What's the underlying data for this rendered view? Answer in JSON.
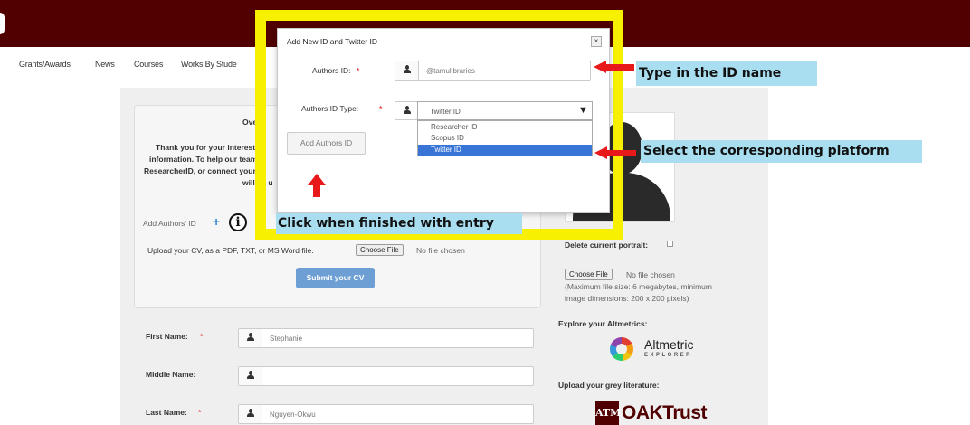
{
  "nav": {
    "items": [
      "Grants/Awards",
      "News",
      "Courses",
      "Works By Stude"
    ]
  },
  "upload_panel": {
    "overview_fragment": "Over",
    "intro_line1": "Thank you for your interest in",
    "intro_line2": "information. To help our team",
    "intro_line3": "ResearcherID, or connect your",
    "intro_line4": "will be u",
    "add_authors_id_label": "Add Authors' ID",
    "upload_cv_text": "Upload your CV, as a PDF, TXT, or MS Word file.",
    "choose_file_label": "Choose File",
    "no_file_text": "No file chosen",
    "submit_cv_label": "Submit your CV"
  },
  "form": {
    "first_name_label": "First Name:",
    "first_name_value": "Stephanie",
    "middle_name_label": "Middle Name:",
    "middle_name_value": "",
    "last_name_label": "Last Name:",
    "last_name_value": "Nguyen-Okwu",
    "required_mark": "*"
  },
  "sidebar": {
    "delete_portrait_label": "Delete current portrait:",
    "choose_file_label": "Choose File",
    "no_file_text": "No file chosen",
    "file_hint_line1": "(Maximum file size: 6 megabytes, minimum",
    "file_hint_line2": "image dimensions: 200 x 200 pixels)",
    "explore_altmetrics": "Explore your Altmetrics:",
    "altmetric_name": "Altmetric",
    "altmetric_sub": "EXPLORER",
    "grey_literature": "Upload your grey literature:",
    "oaktrust_mark": "ATM",
    "oaktrust_name": "OAKTrust"
  },
  "modal": {
    "title": "Add New ID and Twitter ID",
    "close_symbol": "×",
    "authors_id_label": "Authors ID:",
    "authors_id_value": "@tamulibraries",
    "authors_id_type_label": "Authors ID Type:",
    "authors_id_type_value": "Twitter ID",
    "dropdown_arrow": "▼",
    "options": [
      "Researcher ID",
      "Scopus ID",
      "Twitter ID"
    ],
    "selected_option": "Twitter ID",
    "add_button_label": "Add Authors ID",
    "required_mark": "*"
  },
  "annotations": {
    "type_id": "Type in the ID name",
    "select_platform": "Select the corresponding platform",
    "click_finished": "Click when finished with entry",
    "highlight_color": "#f7f000",
    "arrow_color": "#e8191b",
    "callout_bg": "#a9def0"
  },
  "colors": {
    "banner": "#500000",
    "panel_bg": "#efefef",
    "submit_button": "#6e9fd4",
    "selected_option": "#3875d7",
    "required": "#dd0000"
  }
}
